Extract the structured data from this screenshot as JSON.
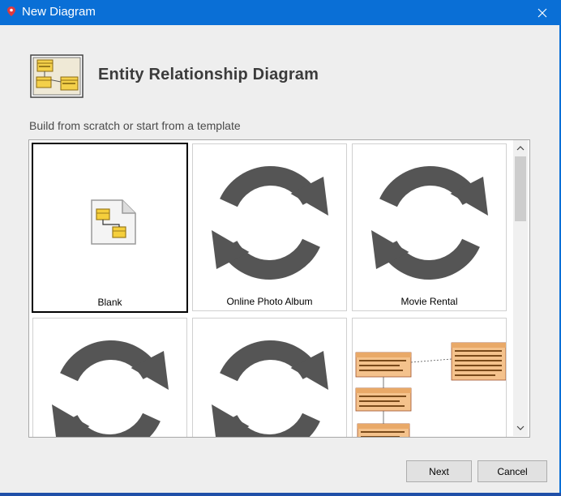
{
  "window": {
    "title": "New Diagram",
    "close_icon": "close-icon"
  },
  "header": {
    "title": "Entity Relationship Diagram",
    "icon": "erd-icon"
  },
  "subtitle": "Build from scratch or start from a template",
  "templates": [
    {
      "label": "Blank",
      "icon": "blank-diagram-icon",
      "selected": true
    },
    {
      "label": "Online Photo Album",
      "icon": "loading-refresh-icon"
    },
    {
      "label": "Movie Rental",
      "icon": "loading-refresh-icon"
    },
    {
      "label": "",
      "icon": "loading-refresh-icon"
    },
    {
      "label": "",
      "icon": "loading-refresh-icon"
    },
    {
      "label": "",
      "icon": "erd-preview-thumbnail"
    }
  ],
  "buttons": {
    "next": "Next",
    "cancel": "Cancel"
  },
  "colors": {
    "titlebar": "#0a6fd6",
    "dialog_bg": "#eeeeee",
    "refresh_icon": "#555555",
    "entity_orange": "#f4c28c"
  }
}
